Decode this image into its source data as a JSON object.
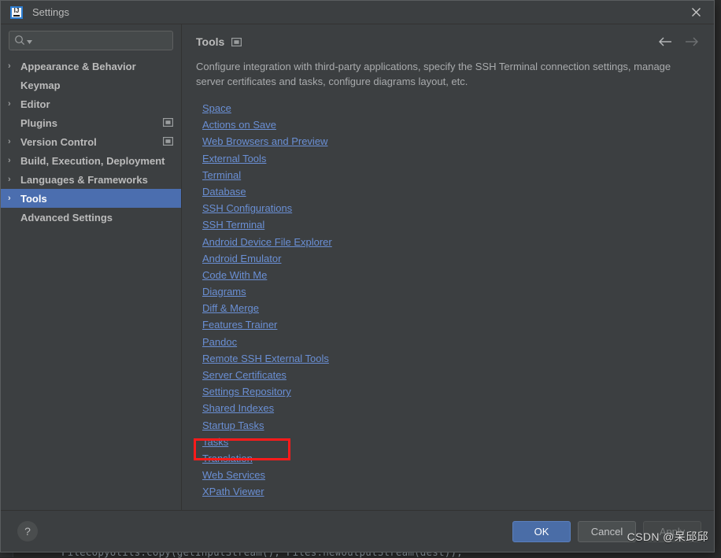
{
  "window": {
    "title": "Settings",
    "logo_text": "IJ",
    "close_icon": "close-icon"
  },
  "search": {
    "value": "",
    "placeholder": "",
    "icon": "search-icon",
    "dropdown_icon": "chevron-down-icon"
  },
  "sidebar": {
    "items": [
      {
        "label": "Appearance & Behavior",
        "expandable": true,
        "selected": false,
        "badge": false
      },
      {
        "label": "Keymap",
        "expandable": false,
        "selected": false,
        "badge": false
      },
      {
        "label": "Editor",
        "expandable": true,
        "selected": false,
        "badge": false
      },
      {
        "label": "Plugins",
        "expandable": false,
        "selected": false,
        "badge": true
      },
      {
        "label": "Version Control",
        "expandable": true,
        "selected": false,
        "badge": true
      },
      {
        "label": "Build, Execution, Deployment",
        "expandable": true,
        "selected": false,
        "badge": false
      },
      {
        "label": "Languages & Frameworks",
        "expandable": true,
        "selected": false,
        "badge": false
      },
      {
        "label": "Tools",
        "expandable": true,
        "selected": true,
        "badge": false
      },
      {
        "label": "Advanced Settings",
        "expandable": false,
        "selected": false,
        "badge": false
      }
    ]
  },
  "content": {
    "title": "Tools",
    "scope_icon": "project-scope-icon",
    "back_icon": "arrow-left-icon",
    "forward_icon": "arrow-right-icon",
    "description": "Configure integration with third-party applications, specify the SSH Terminal connection settings, manage server certificates and tasks, configure diagrams layout, etc.",
    "links": [
      "Space",
      "Actions on Save",
      "Web Browsers and Preview",
      "External Tools",
      "Terminal",
      "Database",
      "SSH Configurations",
      "SSH Terminal",
      "Android Device File Explorer",
      "Android Emulator",
      "Code With Me",
      "Diagrams",
      "Diff & Merge",
      "Features Trainer",
      "Pandoc",
      "Remote SSH External Tools",
      "Server Certificates",
      "Settings Repository",
      "Shared Indexes",
      "Startup Tasks",
      "Tasks",
      "Translation",
      "Web Services",
      "XPath Viewer"
    ],
    "highlighted_link": "Translation"
  },
  "footer": {
    "help_label": "?",
    "ok_label": "OK",
    "cancel_label": "Cancel",
    "apply_label": "Apply"
  },
  "background": {
    "code_line": "FileCopyUtils.copy(getInputStream(), Files.newOutputStream(dest));"
  },
  "watermark": {
    "text": "CSDN @呆邱邱"
  },
  "colors": {
    "dialog_bg": "#3c3f41",
    "selection_blue": "#4b6eaf",
    "link_blue": "#6a8fd4",
    "primary_button": "#4a6da7",
    "annotation_red": "#fc1b1b",
    "editor_bg": "#2b2b2b"
  }
}
